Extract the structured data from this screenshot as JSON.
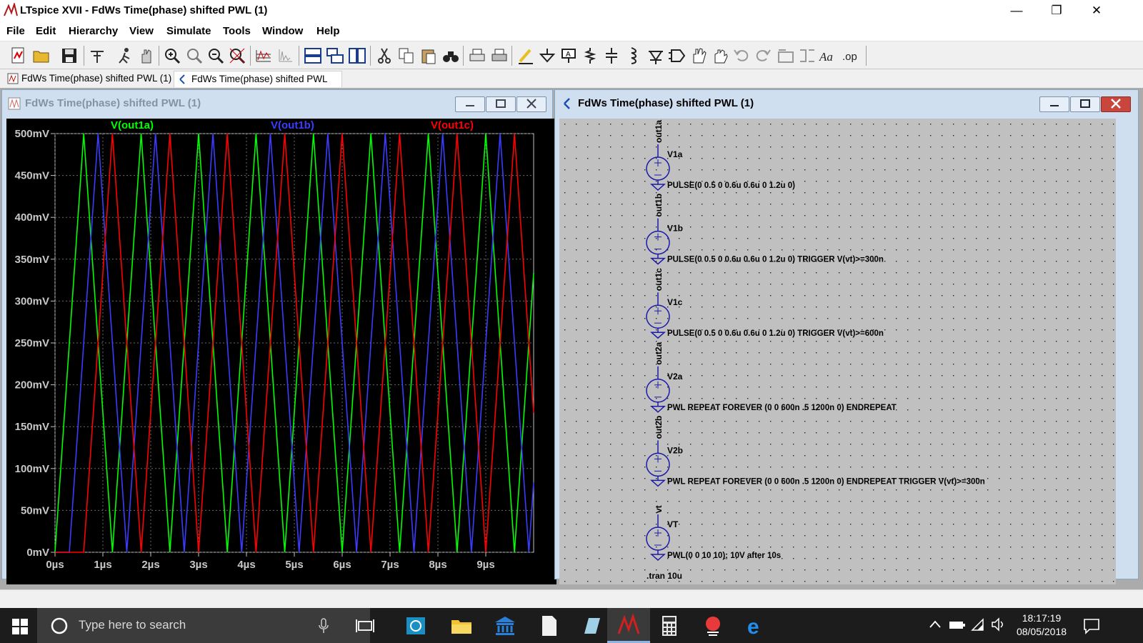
{
  "window": {
    "title": "LTspice XVII - FdWs Time(phase) shifted PWL (1)"
  },
  "menu": [
    "File",
    "Edit",
    "Hierarchy",
    "View",
    "Simulate",
    "Tools",
    "Window",
    "Help"
  ],
  "tabs": [
    {
      "label": "FdWs Time(phase) shifted PWL (1)",
      "icon": "waveform-icon",
      "active": false
    },
    {
      "label": "FdWs Time(phase) shifted PWL (1)",
      "icon": "schematic-icon",
      "active": true
    }
  ],
  "plot_window": {
    "title": "FdWs Time(phase) shifted PWL (1)",
    "traces": [
      {
        "label": "V(out1a)",
        "color": "#00ff00"
      },
      {
        "label": "V(out1b)",
        "color": "#3c3cff"
      },
      {
        "label": "V(out1c)",
        "color": "#ff0000"
      }
    ],
    "y_ticks": [
      "500mV",
      "450mV",
      "400mV",
      "350mV",
      "300mV",
      "250mV",
      "200mV",
      "150mV",
      "100mV",
      "50mV",
      "0mV"
    ],
    "x_ticks": [
      "0µs",
      "1µs",
      "2µs",
      "3µs",
      "4µs",
      "5µs",
      "6µs",
      "7µs",
      "8µs",
      "9µs"
    ]
  },
  "chart_data": {
    "type": "line",
    "x_unit": "µs",
    "y_unit": "mV",
    "xlim": [
      0,
      10
    ],
    "ylim": [
      0,
      500
    ],
    "grid": true,
    "series": [
      {
        "name": "V(out1a)",
        "color": "#00ff00",
        "shape": "triangle",
        "period_us": 1.2,
        "delay_us": 0,
        "min_mV": 0,
        "max_mV": 500
      },
      {
        "name": "V(out1b)",
        "color": "#3c3cff",
        "shape": "triangle",
        "period_us": 1.2,
        "delay_us": 0.3,
        "min_mV": 0,
        "max_mV": 500
      },
      {
        "name": "V(out1c)",
        "color": "#ff0000",
        "shape": "triangle",
        "period_us": 1.2,
        "delay_us": 0.6,
        "min_mV": 0,
        "max_mV": 500
      }
    ]
  },
  "schematic_window": {
    "title": "FdWs Time(phase) shifted PWL (1)",
    "sources": [
      {
        "net": "out1a",
        "name": "V1a",
        "value": "PULSE(0 0.5 0 0.6u 0.6u 0 1.2u 0)"
      },
      {
        "net": "out1b",
        "name": "V1b",
        "value": "PULSE(0 0.5 0 0.6u 0.6u 0 1.2u 0) TRIGGER V(vt)>=300n"
      },
      {
        "net": "out1c",
        "name": "V1c",
        "value": "PULSE(0 0.5 0 0.6u 0.6u 0 1.2u 0) TRIGGER V(vt)>=600n"
      },
      {
        "net": "out2a",
        "name": "V2a",
        "value": "PWL REPEAT FOREVER (0 0 600n .5 1200n 0) ENDREPEAT"
      },
      {
        "net": "out2b",
        "name": "V2b",
        "value": "PWL REPEAT FOREVER (0 0 600n .5 1200n 0) ENDREPEAT TRIGGER V(vt)>=300n"
      },
      {
        "net": "vt",
        "name": "VT",
        "value": "PWL(0 0 10 10); 10V after 10s"
      }
    ],
    "directive": ".tran 10u"
  },
  "taskbar": {
    "search_placeholder": "Type here to search",
    "time": "18:17:19",
    "date": "08/05/2018"
  }
}
